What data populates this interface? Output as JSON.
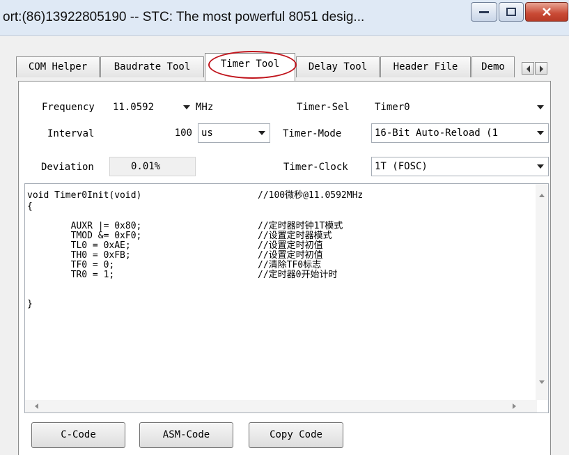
{
  "window": {
    "title": "ort:(86)13922805190  -- STC: The most powerful 8051 desig..."
  },
  "tabs": [
    {
      "label": "COM Helper",
      "active": false
    },
    {
      "label": "Baudrate Tool",
      "active": false
    },
    {
      "label": "Timer Tool",
      "active": true
    },
    {
      "label": "Delay Tool",
      "active": false
    },
    {
      "label": "Header File",
      "active": false
    },
    {
      "label": "Demo",
      "active": false
    }
  ],
  "form": {
    "frequency": {
      "label": "Frequency",
      "value": "11.0592",
      "unit": "MHz"
    },
    "interval": {
      "label": "Interval",
      "value": "100",
      "unit": "us"
    },
    "deviation": {
      "label": "Deviation",
      "value": "0.01%"
    },
    "timer_sel": {
      "label": "Timer-Sel",
      "value": "Timer0"
    },
    "timer_mode": {
      "label": "Timer-Mode",
      "value": "16-Bit Auto-Reload (1"
    },
    "timer_clock": {
      "label": "Timer-Clock",
      "value": "1T   (FOSC)"
    }
  },
  "code": {
    "lines": [
      "void Timer0Init(void)",
      "{",
      "        AUXR |= 0x80;",
      "        TMOD &= 0xF0;",
      "        TL0 = 0xAE;",
      "        TH0 = 0xFB;",
      "        TF0 = 0;",
      "        TR0 = 1;",
      "}"
    ],
    "comments": [
      "//100微秒@11.0592MHz",
      "",
      "//定时器时钟1T模式",
      "//设置定时器模式",
      "//设置定时初值",
      "//设置定时初值",
      "//清除TF0标志",
      "//定时器0开始计时",
      ""
    ]
  },
  "buttons": {
    "c_code": "C-Code",
    "asm_code": "ASM-Code",
    "copy_code": "Copy Code"
  },
  "colors": {
    "highlight_circle": "#c0141c",
    "titlebar": "#dfe9f5",
    "close_button": "#c94a35"
  }
}
